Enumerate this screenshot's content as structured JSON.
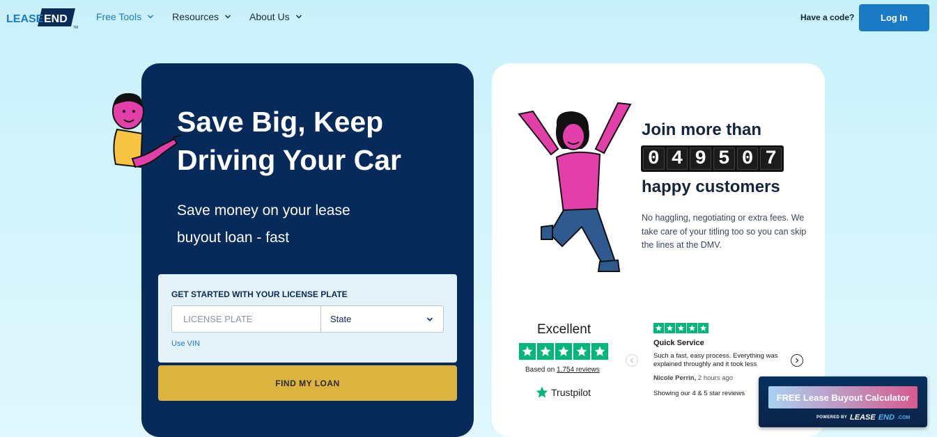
{
  "header": {
    "logo_text_left": "LEASE",
    "logo_text_right": "END",
    "logo_tm": "TM",
    "nav": [
      {
        "label": "Free Tools",
        "active": true
      },
      {
        "label": "Resources",
        "active": false
      },
      {
        "label": "About Us",
        "active": false
      }
    ],
    "have_code": "Have a code?",
    "login_label": "Log In"
  },
  "hero": {
    "title_line1": "Save Big, Keep",
    "title_line2": "Driving Your Car",
    "subtitle_line1": "Save money on your lease",
    "subtitle_line2": "buyout loan - fast"
  },
  "plate_form": {
    "heading": "GET STARTED WITH YOUR LICENSE PLATE",
    "plate_placeholder": "LICENSE PLATE",
    "state_label": "State",
    "use_vin": "Use VIN",
    "find_button": "FIND MY LOAN"
  },
  "customers": {
    "join_text": "Join more than",
    "digits": [
      "0",
      "4",
      "9",
      "5",
      "0",
      "7"
    ],
    "happy_text": "happy customers",
    "description": "No haggling, negotiating or extra fees. We take care of your titling too so you can skip the lines at the DMV."
  },
  "trustpilot": {
    "rating_word": "Excellent",
    "stars": 5,
    "based_on_prefix": "Based on ",
    "reviews_count": "1,754 reviews",
    "brand": "Trustpilot",
    "review": {
      "stars": 5,
      "title": "Quick Service",
      "text": "Such a fast, easy process. Everything was explained throughly and it took less",
      "author": "Nicole Perrin,",
      "time": "2 hours ago"
    },
    "showing": "Showing our 4 & 5 star reviews"
  },
  "calculator_widget": {
    "button_label": "FREE Lease Buyout Calculator",
    "powered_by": "POWERED BY",
    "brand_left": "LEASE",
    "brand_right": "END",
    "brand_suffix": ".COM"
  },
  "colors": {
    "brand_blue": "#1a7bc4",
    "navy": "#062b5a",
    "gold": "#dcb33e",
    "trustpilot_green": "#00b67a",
    "pink": "#e23fa8"
  }
}
